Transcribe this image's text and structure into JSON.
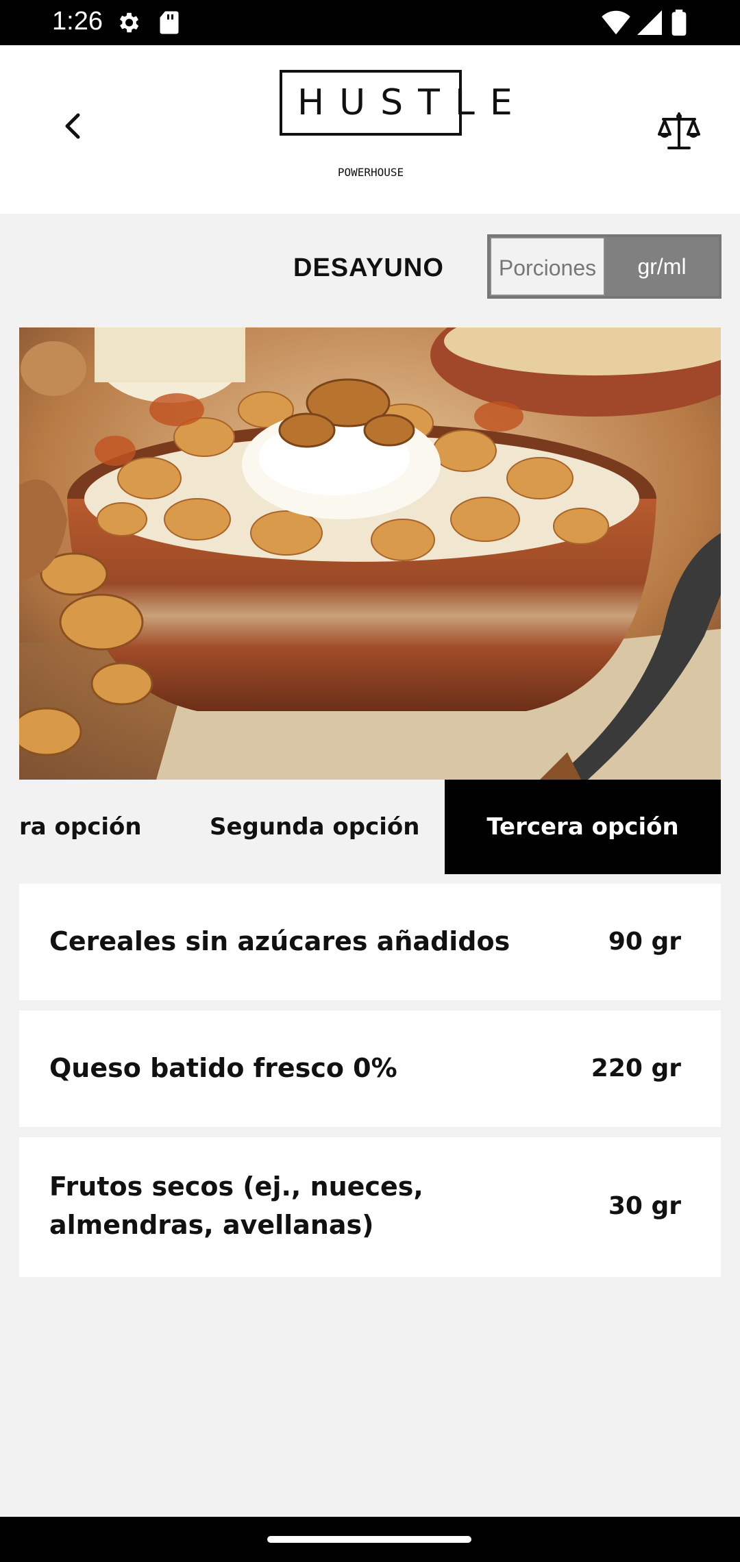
{
  "status_bar": {
    "time": "1:26"
  },
  "header": {
    "logo_word": "HUSTLE",
    "logo_sub": "POWERHOUSE"
  },
  "meal": {
    "title": "DESAYUNO",
    "toggle": {
      "left": "Porciones",
      "right": "gr/ml",
      "selected": "gr/ml"
    }
  },
  "tabs": [
    {
      "label": "ra opción",
      "active": false
    },
    {
      "label": "Segunda opción",
      "active": false
    },
    {
      "label": "Tercera opción",
      "active": true
    }
  ],
  "ingredients": [
    {
      "name": "Cereales sin azúcares añadidos",
      "qty": "90 gr"
    },
    {
      "name": "Queso batido fresco 0%",
      "qty": "220 gr"
    },
    {
      "name": "Frutos secos (ej., nueces, almendras, avellanas)",
      "qty": "30 gr"
    }
  ],
  "hero_image": {
    "description_icon": "cereal-bowl-image"
  }
}
